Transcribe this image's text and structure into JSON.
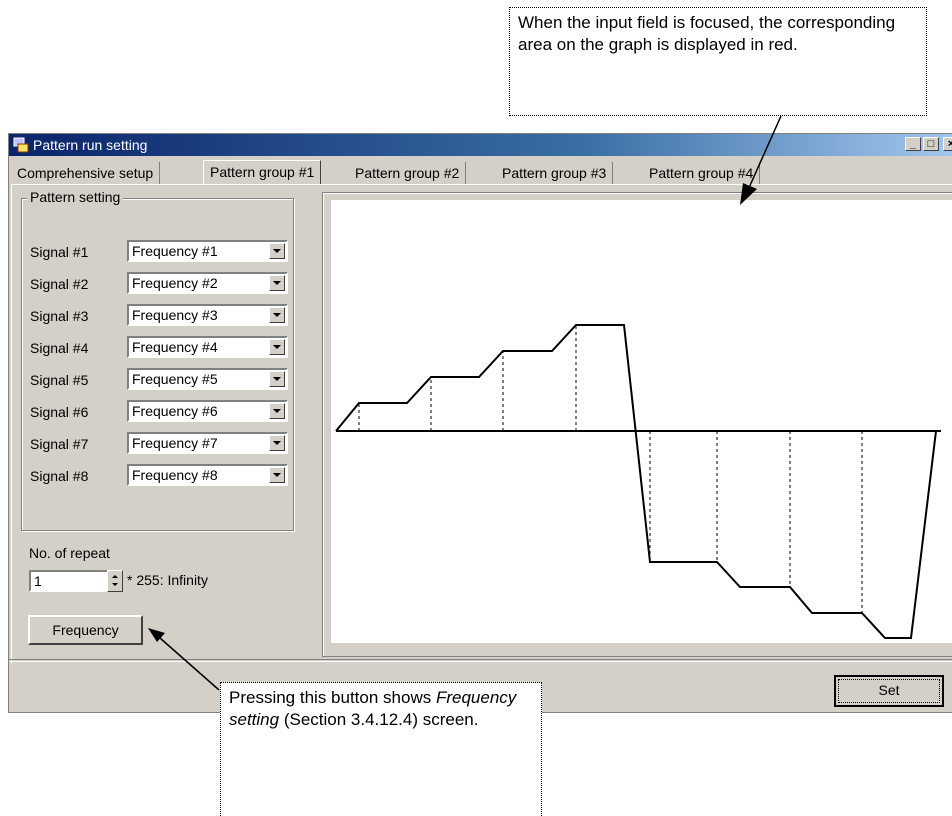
{
  "callouts": {
    "top": "When the input field is focused, the corresponding area on the graph is displayed in red.",
    "bottom_pre": "Pressing this button shows ",
    "bottom_em": "Frequency setting",
    "bottom_post": " (Section 3.4.12.4) screen."
  },
  "window": {
    "title": "Pattern run setting",
    "minimize_glyph": "_",
    "maximize_glyph": "□",
    "close_glyph": "×"
  },
  "tabs": [
    {
      "label": "Comprehensive setup",
      "active": false
    },
    {
      "label": "Pattern group #1",
      "active": true
    },
    {
      "label": "Pattern group #2",
      "active": false
    },
    {
      "label": "Pattern group #3",
      "active": false
    },
    {
      "label": "Pattern group #4",
      "active": false
    }
  ],
  "pattern_setting": {
    "legend": "Pattern setting",
    "signals": [
      {
        "label": "Signal #1",
        "value": "Frequency #1"
      },
      {
        "label": "Signal #2",
        "value": "Frequency #2"
      },
      {
        "label": "Signal #3",
        "value": "Frequency #3"
      },
      {
        "label": "Signal #4",
        "value": "Frequency #4"
      },
      {
        "label": "Signal #5",
        "value": "Frequency #5"
      },
      {
        "label": "Signal #6",
        "value": "Frequency #6"
      },
      {
        "label": "Signal #7",
        "value": "Frequency #7"
      },
      {
        "label": "Signal #8",
        "value": "Frequency #8"
      }
    ]
  },
  "repeat": {
    "label": "No. of repeat",
    "value": "1",
    "note": "* 255: Infinity"
  },
  "buttons": {
    "frequency": "Frequency",
    "set": "Set"
  },
  "colors": {
    "titlebar_start": "#0a246a",
    "titlebar_end": "#a6caf0",
    "dialog_face": "#d4d0c8"
  },
  "graph": {
    "description_levels": [
      1,
      2,
      3,
      4,
      -1,
      -2,
      -3,
      -4
    ]
  }
}
